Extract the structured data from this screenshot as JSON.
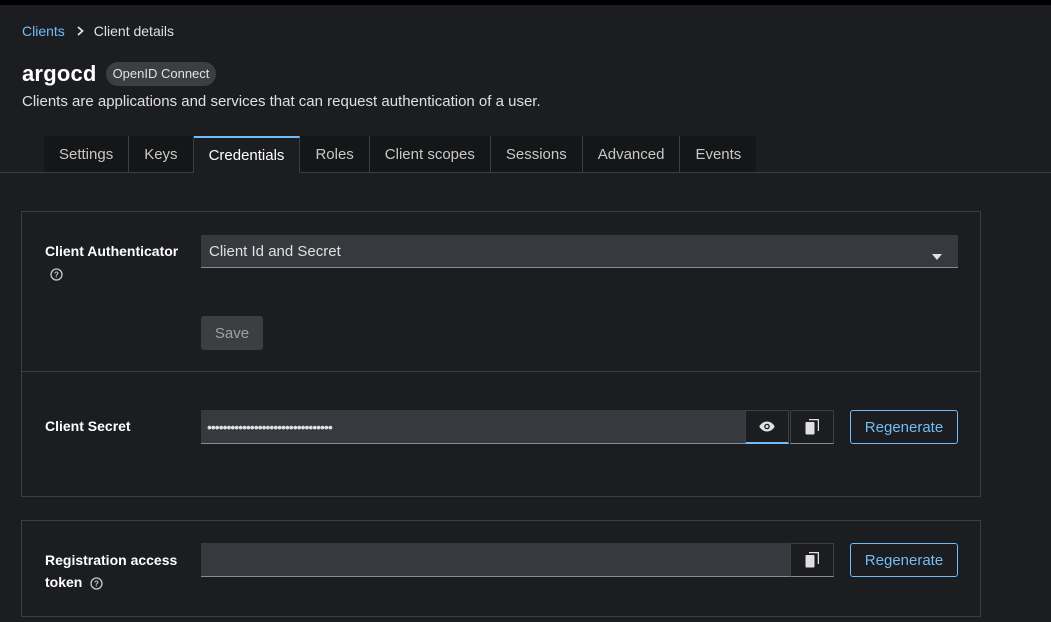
{
  "breadcrumb": {
    "parent": "Clients",
    "current": "Client details"
  },
  "header": {
    "title": "argocd",
    "badge": "OpenID Connect",
    "description": "Clients are applications and services that can request authentication of a user."
  },
  "tabs": [
    {
      "label": "Settings",
      "active": false
    },
    {
      "label": "Keys",
      "active": false
    },
    {
      "label": "Credentials",
      "active": true
    },
    {
      "label": "Roles",
      "active": false
    },
    {
      "label": "Client scopes",
      "active": false
    },
    {
      "label": "Sessions",
      "active": false
    },
    {
      "label": "Advanced",
      "active": false
    },
    {
      "label": "Events",
      "active": false
    }
  ],
  "authenticator": {
    "label": "Client Authenticator",
    "selected": "Client Id and Secret",
    "save_label": "Save"
  },
  "secret": {
    "label": "Client Secret",
    "masked_value": "••••••••••••••••••••••••••••••••",
    "regenerate_label": "Regenerate"
  },
  "registration_token": {
    "label_line1": "Registration access",
    "label_line2": "token",
    "value": "",
    "regenerate_label": "Regenerate"
  },
  "colors": {
    "accent": "#73bcf7",
    "background": "#1b1d21",
    "input_bg": "#36393d"
  }
}
